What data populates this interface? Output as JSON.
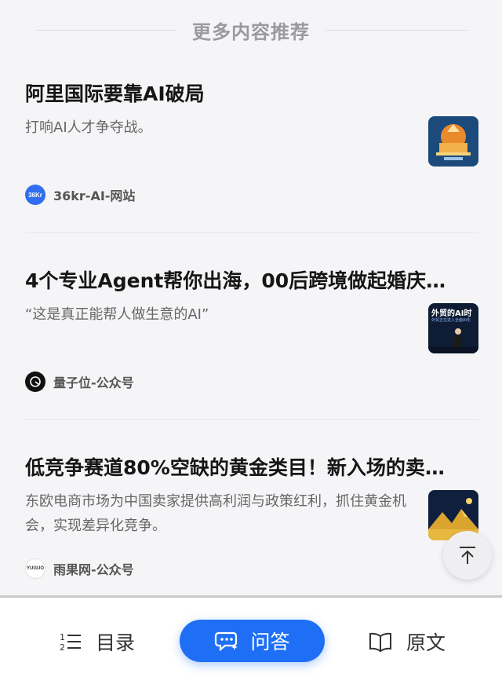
{
  "section": {
    "title": "更多内容推荐"
  },
  "articles": [
    {
      "title": "阿里国际要靠AI破局",
      "summary": "打响AI人才争夺战。",
      "source": "36kr-AI-网站",
      "source_logo_text": "36Kr",
      "thumb_icon": "ai-scene-thumbnail"
    },
    {
      "title": "4个专业Agent帮你出海，00后跨境做起婚庆…",
      "summary": "“这是真正能帮人做生意的AI”",
      "source": "量子位-公众号",
      "thumb_text": "外贸的AI时",
      "thumb_subtext": "外贸正在进入全面AI化",
      "thumb_icon": "presenter-stage-thumbnail"
    },
    {
      "title": "低竞争赛道80%空缺的黄金类目！新入场的卖…",
      "summary": "东欧电商市场为中国卖家提供高利润与政策红利，抓住黄金机会，实现差异化竞争。",
      "source": "雨果网-公众号",
      "source_logo_text": "YUGUO",
      "thumb_icon": "golden-mountain-thumbnail"
    }
  ],
  "toolbar": {
    "toc_label": "目录",
    "ask_label": "问答",
    "original_label": "原文"
  },
  "colors": {
    "accent": "#1e6ff5",
    "background": "#f5f5f7"
  }
}
